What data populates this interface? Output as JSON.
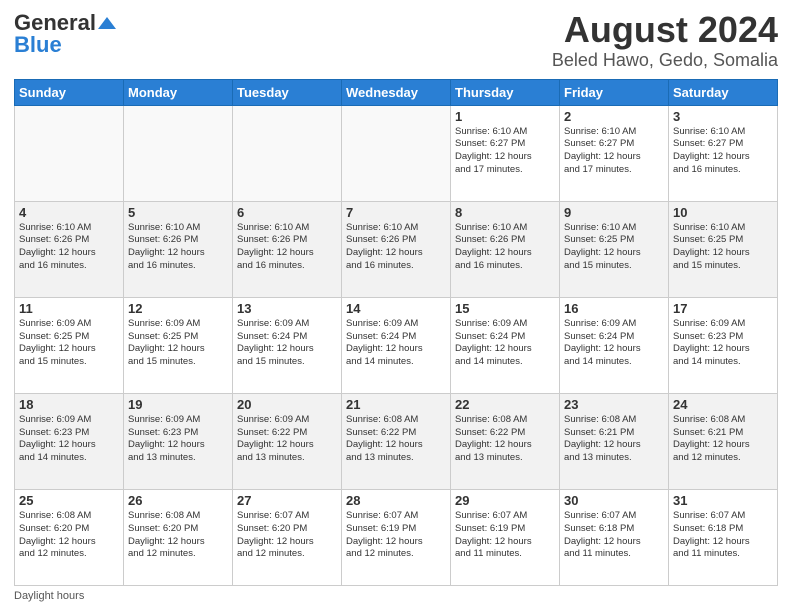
{
  "logo": {
    "line1": "General",
    "line2": "Blue"
  },
  "title": "August 2024",
  "subtitle": "Beled Hawo, Gedo, Somalia",
  "days_header": [
    "Sunday",
    "Monday",
    "Tuesday",
    "Wednesday",
    "Thursday",
    "Friday",
    "Saturday"
  ],
  "weeks": [
    [
      {
        "day": "",
        "info": ""
      },
      {
        "day": "",
        "info": ""
      },
      {
        "day": "",
        "info": ""
      },
      {
        "day": "",
        "info": ""
      },
      {
        "day": "1",
        "info": "Sunrise: 6:10 AM\nSunset: 6:27 PM\nDaylight: 12 hours\nand 17 minutes."
      },
      {
        "day": "2",
        "info": "Sunrise: 6:10 AM\nSunset: 6:27 PM\nDaylight: 12 hours\nand 17 minutes."
      },
      {
        "day": "3",
        "info": "Sunrise: 6:10 AM\nSunset: 6:27 PM\nDaylight: 12 hours\nand 16 minutes."
      }
    ],
    [
      {
        "day": "4",
        "info": "Sunrise: 6:10 AM\nSunset: 6:26 PM\nDaylight: 12 hours\nand 16 minutes."
      },
      {
        "day": "5",
        "info": "Sunrise: 6:10 AM\nSunset: 6:26 PM\nDaylight: 12 hours\nand 16 minutes."
      },
      {
        "day": "6",
        "info": "Sunrise: 6:10 AM\nSunset: 6:26 PM\nDaylight: 12 hours\nand 16 minutes."
      },
      {
        "day": "7",
        "info": "Sunrise: 6:10 AM\nSunset: 6:26 PM\nDaylight: 12 hours\nand 16 minutes."
      },
      {
        "day": "8",
        "info": "Sunrise: 6:10 AM\nSunset: 6:26 PM\nDaylight: 12 hours\nand 16 minutes."
      },
      {
        "day": "9",
        "info": "Sunrise: 6:10 AM\nSunset: 6:25 PM\nDaylight: 12 hours\nand 15 minutes."
      },
      {
        "day": "10",
        "info": "Sunrise: 6:10 AM\nSunset: 6:25 PM\nDaylight: 12 hours\nand 15 minutes."
      }
    ],
    [
      {
        "day": "11",
        "info": "Sunrise: 6:09 AM\nSunset: 6:25 PM\nDaylight: 12 hours\nand 15 minutes."
      },
      {
        "day": "12",
        "info": "Sunrise: 6:09 AM\nSunset: 6:25 PM\nDaylight: 12 hours\nand 15 minutes."
      },
      {
        "day": "13",
        "info": "Sunrise: 6:09 AM\nSunset: 6:24 PM\nDaylight: 12 hours\nand 15 minutes."
      },
      {
        "day": "14",
        "info": "Sunrise: 6:09 AM\nSunset: 6:24 PM\nDaylight: 12 hours\nand 14 minutes."
      },
      {
        "day": "15",
        "info": "Sunrise: 6:09 AM\nSunset: 6:24 PM\nDaylight: 12 hours\nand 14 minutes."
      },
      {
        "day": "16",
        "info": "Sunrise: 6:09 AM\nSunset: 6:24 PM\nDaylight: 12 hours\nand 14 minutes."
      },
      {
        "day": "17",
        "info": "Sunrise: 6:09 AM\nSunset: 6:23 PM\nDaylight: 12 hours\nand 14 minutes."
      }
    ],
    [
      {
        "day": "18",
        "info": "Sunrise: 6:09 AM\nSunset: 6:23 PM\nDaylight: 12 hours\nand 14 minutes."
      },
      {
        "day": "19",
        "info": "Sunrise: 6:09 AM\nSunset: 6:23 PM\nDaylight: 12 hours\nand 13 minutes."
      },
      {
        "day": "20",
        "info": "Sunrise: 6:09 AM\nSunset: 6:22 PM\nDaylight: 12 hours\nand 13 minutes."
      },
      {
        "day": "21",
        "info": "Sunrise: 6:08 AM\nSunset: 6:22 PM\nDaylight: 12 hours\nand 13 minutes."
      },
      {
        "day": "22",
        "info": "Sunrise: 6:08 AM\nSunset: 6:22 PM\nDaylight: 12 hours\nand 13 minutes."
      },
      {
        "day": "23",
        "info": "Sunrise: 6:08 AM\nSunset: 6:21 PM\nDaylight: 12 hours\nand 13 minutes."
      },
      {
        "day": "24",
        "info": "Sunrise: 6:08 AM\nSunset: 6:21 PM\nDaylight: 12 hours\nand 12 minutes."
      }
    ],
    [
      {
        "day": "25",
        "info": "Sunrise: 6:08 AM\nSunset: 6:20 PM\nDaylight: 12 hours\nand 12 minutes."
      },
      {
        "day": "26",
        "info": "Sunrise: 6:08 AM\nSunset: 6:20 PM\nDaylight: 12 hours\nand 12 minutes."
      },
      {
        "day": "27",
        "info": "Sunrise: 6:07 AM\nSunset: 6:20 PM\nDaylight: 12 hours\nand 12 minutes."
      },
      {
        "day": "28",
        "info": "Sunrise: 6:07 AM\nSunset: 6:19 PM\nDaylight: 12 hours\nand 12 minutes."
      },
      {
        "day": "29",
        "info": "Sunrise: 6:07 AM\nSunset: 6:19 PM\nDaylight: 12 hours\nand 11 minutes."
      },
      {
        "day": "30",
        "info": "Sunrise: 6:07 AM\nSunset: 6:18 PM\nDaylight: 12 hours\nand 11 minutes."
      },
      {
        "day": "31",
        "info": "Sunrise: 6:07 AM\nSunset: 6:18 PM\nDaylight: 12 hours\nand 11 minutes."
      }
    ]
  ],
  "footer": "Daylight hours"
}
